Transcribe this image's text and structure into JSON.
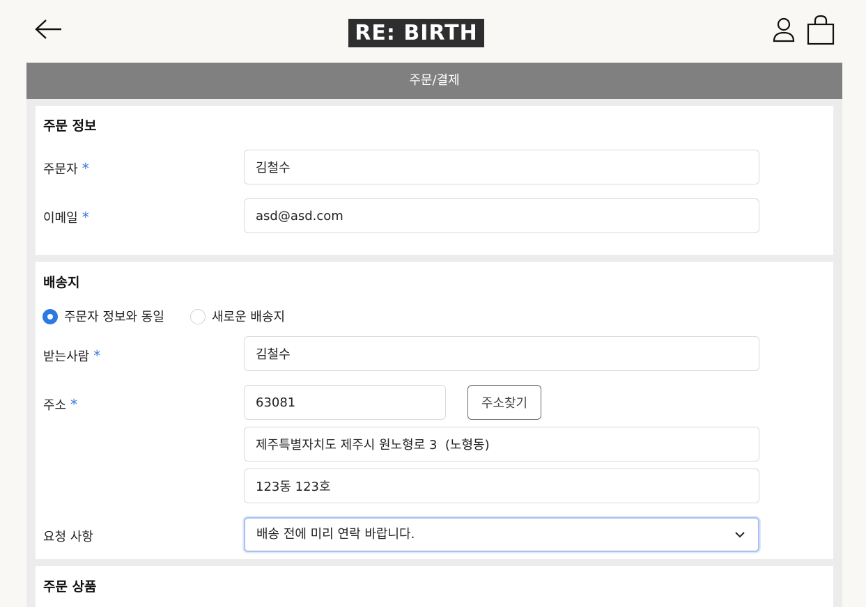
{
  "header": {
    "logo_text": "RE: BIRTH",
    "back_icon": "arrow-left-icon",
    "user_icon": "user-icon",
    "bag_icon": "shopping-bag-icon"
  },
  "page_title": "주문/결제",
  "order_info": {
    "title": "주문 정보",
    "orderer_label": "주문자",
    "orderer_value": "김철수",
    "email_label": "이메일",
    "email_value": "asd@asd.com",
    "required_mark": "*"
  },
  "shipping": {
    "title": "배송지",
    "radio_same": "주문자 정보와 동일",
    "radio_new": "새로운 배송지",
    "selected_option": "주문자 정보와 동일",
    "recipient_label": "받는사람",
    "recipient_value": "김철수",
    "address_label": "주소",
    "postcode_value": "63081",
    "find_address_button": "주소찾기",
    "address_line1": "제주특별자치도 제주시 원노형로 3  (노형동)",
    "address_line2": "123동 123호",
    "request_label": "요청 사항",
    "request_value": "배송 전에 미리 연락 바랍니다."
  },
  "products": {
    "title": "주문 상품"
  },
  "colors": {
    "accent": "#2b7ae0",
    "required_mark": "#3a7bd5",
    "page_bar": "#808080",
    "logo_bg": "#2e2e2e"
  }
}
